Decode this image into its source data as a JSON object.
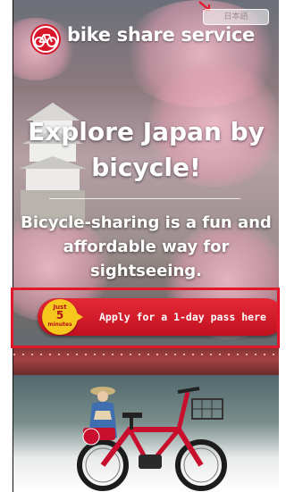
{
  "header": {
    "brand_name": "bike share service",
    "language_button": "日本語",
    "logo_icon": "bicycle-logo-icon"
  },
  "hero": {
    "title": "Explore Japan by bicycle!",
    "subtitle": "Bicycle-sharing is a fun and affordable way for sightseeing."
  },
  "cta": {
    "badge_top": "Just",
    "badge_number": "5",
    "badge_unit": "minutes",
    "label": "Apply for a 1-day pass here"
  },
  "colors": {
    "brand_red": "#c2101f",
    "badge_yellow": "#f6c81e",
    "highlight_red": "#e3172a"
  },
  "bike_label": "bike share"
}
